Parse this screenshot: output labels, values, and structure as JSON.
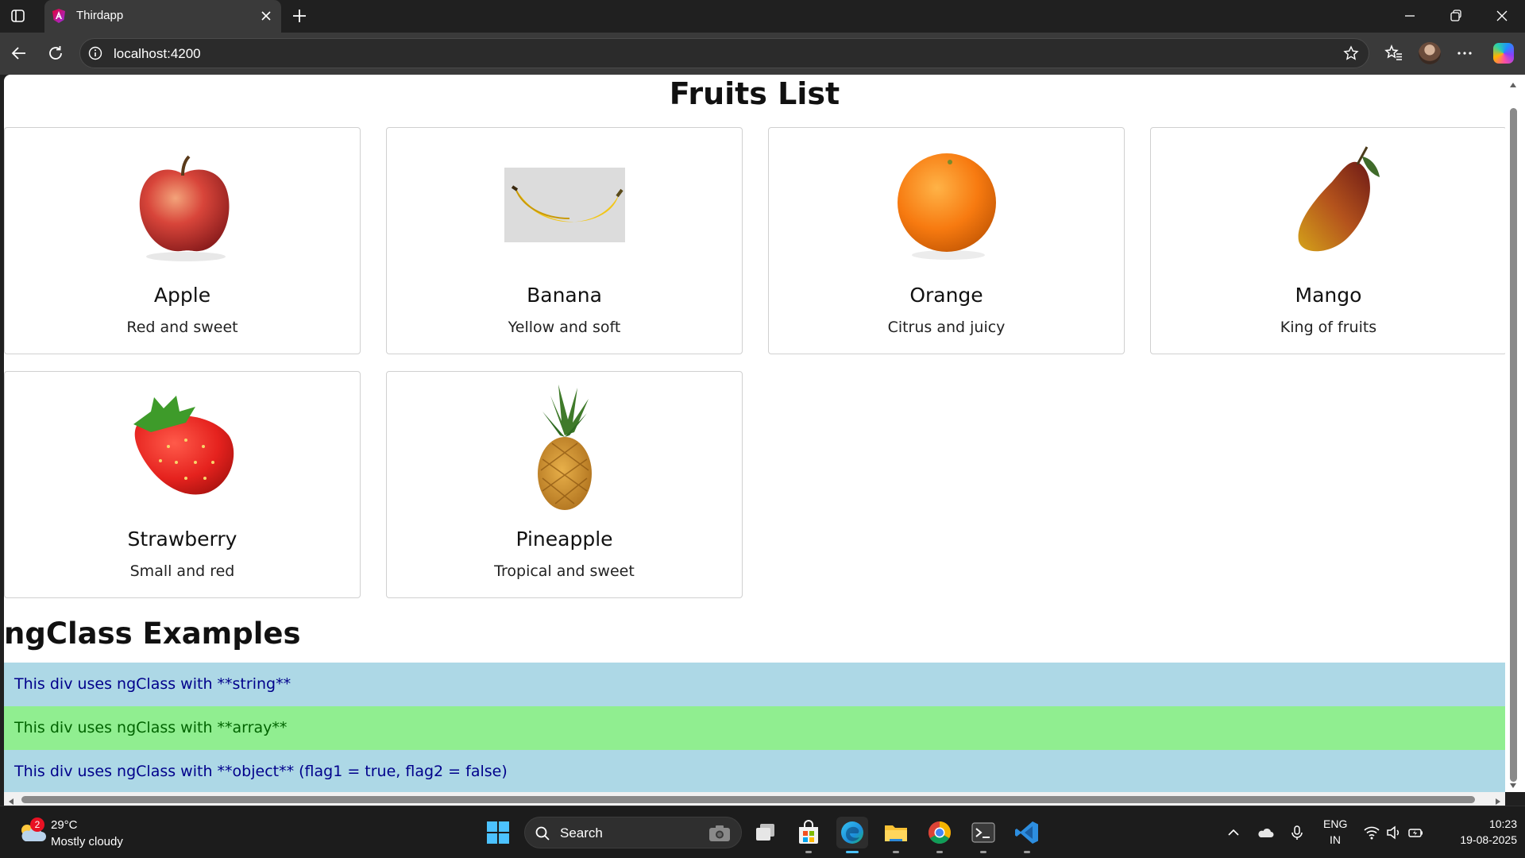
{
  "browser": {
    "tab": {
      "title": "Thirdapp"
    },
    "url": "localhost:4200"
  },
  "page": {
    "title": "Fruits List",
    "fruits": [
      {
        "name": "Apple",
        "description": "Red and sweet",
        "image_icon": "apple-image"
      },
      {
        "name": "Banana",
        "description": "Yellow and soft",
        "image_icon": "banana-image"
      },
      {
        "name": "Orange",
        "description": "Citrus and juicy",
        "image_icon": "orange-image"
      },
      {
        "name": "Mango",
        "description": "King of fruits",
        "image_icon": "mango-image"
      },
      {
        "name": "Strawberry",
        "description": "Small and red",
        "image_icon": "strawberry-image"
      },
      {
        "name": "Pineapple",
        "description": "Tropical and sweet",
        "image_icon": "pineapple-image"
      }
    ],
    "ngclass_section": {
      "title": "ngClass Examples",
      "rows": [
        {
          "text": "This div uses ngClass with **string**",
          "bg": "#add8e6",
          "color": "#00008b"
        },
        {
          "text": "This div uses ngClass with **array**",
          "bg": "#90ee90",
          "color": "#006400"
        },
        {
          "text": "This div uses ngClass with **object** (flag1 = true, flag2 = false)",
          "bg": "#add8e6",
          "color": "#00008b"
        }
      ]
    }
  },
  "taskbar": {
    "weather": {
      "badge": "2",
      "temp": "29°C",
      "desc": "Mostly cloudy"
    },
    "search_label": "Search",
    "language": {
      "line1": "ENG",
      "line2": "IN"
    },
    "clock": {
      "time": "10:23",
      "date": "19-08-2025"
    },
    "pinned": [
      "task-view",
      "microsoft-store",
      "edge",
      "file-explorer",
      "chrome",
      "terminal",
      "vscode"
    ]
  }
}
